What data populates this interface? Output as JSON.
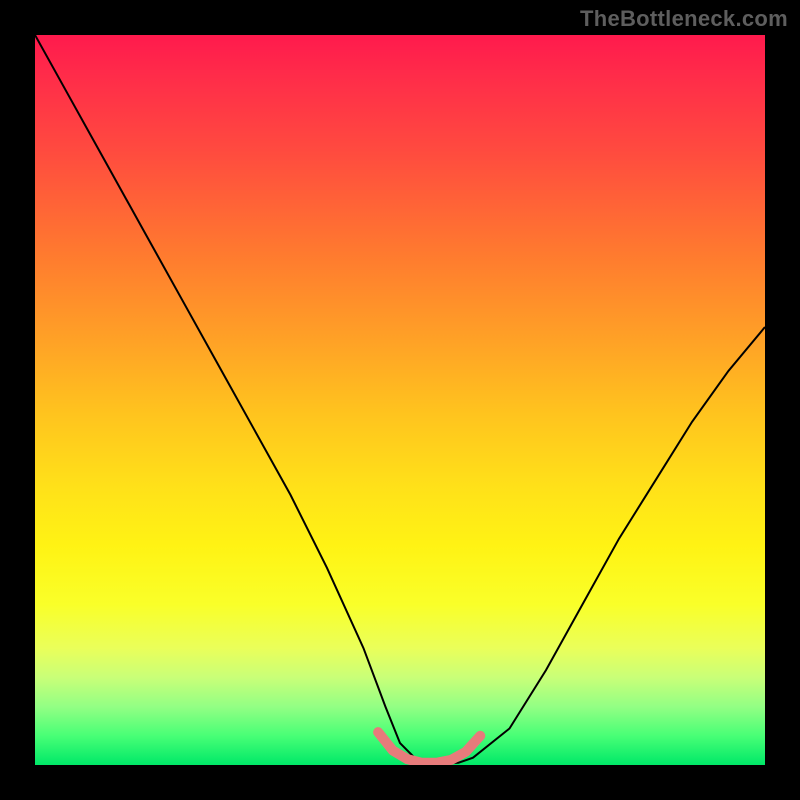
{
  "watermark": "TheBottleneck.com",
  "chart_data": {
    "type": "line",
    "title": "",
    "xlabel": "",
    "ylabel": "",
    "xlim": [
      0,
      100
    ],
    "ylim": [
      0,
      100
    ],
    "grid": false,
    "legend": false,
    "series": [
      {
        "name": "bottleneck-curve",
        "color": "#000000",
        "stroke_width": 2,
        "x": [
          0,
          5,
          10,
          15,
          20,
          25,
          30,
          35,
          40,
          45,
          48,
          50,
          52,
          54,
          56,
          58,
          60,
          65,
          70,
          75,
          80,
          85,
          90,
          95,
          100
        ],
        "y": [
          100,
          91,
          82,
          73,
          64,
          55,
          46,
          37,
          27,
          16,
          8,
          3,
          1,
          0.3,
          0.2,
          0.3,
          1,
          5,
          13,
          22,
          31,
          39,
          47,
          54,
          60
        ]
      },
      {
        "name": "optimal-zone",
        "color": "#e77b7b",
        "stroke_width": 10,
        "linecap": "round",
        "x": [
          47,
          49,
          51,
          53,
          55,
          57,
          59,
          61
        ],
        "y": [
          4.5,
          2.0,
          0.8,
          0.3,
          0.3,
          0.7,
          1.8,
          4.0
        ]
      }
    ],
    "background_gradient": {
      "direction": "vertical",
      "stops": [
        {
          "pos": 0,
          "color": "#ff1a4d"
        },
        {
          "pos": 20,
          "color": "#ff5a38"
        },
        {
          "pos": 45,
          "color": "#ffb020"
        },
        {
          "pos": 65,
          "color": "#ffe818"
        },
        {
          "pos": 80,
          "color": "#f4ff3a"
        },
        {
          "pos": 92,
          "color": "#9cff80"
        },
        {
          "pos": 100,
          "color": "#00e868"
        }
      ]
    }
  }
}
